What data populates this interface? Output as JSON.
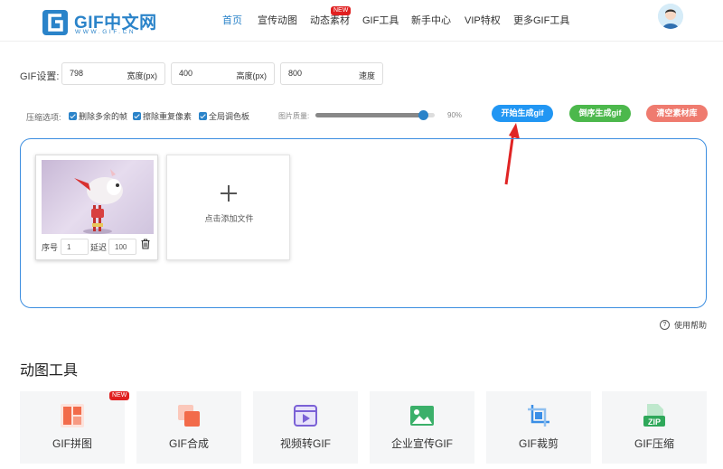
{
  "header": {
    "logo_text": "GIF中文网",
    "logo_sub": "WWW.GIF.CN",
    "nav": [
      {
        "label": "首页",
        "active": true
      },
      {
        "label": "宣传动图"
      },
      {
        "label": "动态素材",
        "badge": "NEW"
      },
      {
        "label": "GIF工具"
      },
      {
        "label": "新手中心"
      },
      {
        "label": "VIP特权"
      },
      {
        "label": "更多GIF工具"
      }
    ]
  },
  "settings": {
    "label": "GIF设置:",
    "fields": [
      {
        "value": "798",
        "unit": "宽度(px)"
      },
      {
        "value": "400",
        "unit": "高度(px)"
      },
      {
        "value": "800",
        "unit": "速度"
      }
    ]
  },
  "compress": {
    "label": "压缩选项:",
    "options": [
      {
        "label": "删除多余的帧",
        "checked": true
      },
      {
        "label": "擦除重复像素",
        "checked": true
      },
      {
        "label": "全局调色板",
        "checked": true
      }
    ],
    "quality_label": "图片质量:",
    "quality_value": "90%",
    "quality_fraction": 0.9
  },
  "actions": {
    "start": "开始生成gif",
    "reverse": "倒序生成gif",
    "clear": "清空素材库"
  },
  "frames": [
    {
      "seq_label": "序号",
      "seq": "1",
      "delay_label": "延迟",
      "delay": "100"
    }
  ],
  "add_file": "点击添加文件",
  "help": "使用帮助",
  "tools": {
    "title": "动图工具",
    "items": [
      {
        "label": "GIF拼图",
        "icon": "collage-icon",
        "badge": "NEW"
      },
      {
        "label": "GIF合成",
        "icon": "merge-icon"
      },
      {
        "label": "视频转GIF",
        "icon": "video-icon"
      },
      {
        "label": "企业宣传GIF",
        "icon": "image-icon"
      },
      {
        "label": "GIF裁剪",
        "icon": "crop-icon"
      },
      {
        "label": "GIF压缩",
        "icon": "zip-icon"
      }
    ]
  },
  "colors": {
    "brand": "#2a83c9",
    "start": "#2196f3",
    "reverse": "#4cb84c",
    "clear": "#ef7b6f",
    "badge": "#e02020"
  }
}
